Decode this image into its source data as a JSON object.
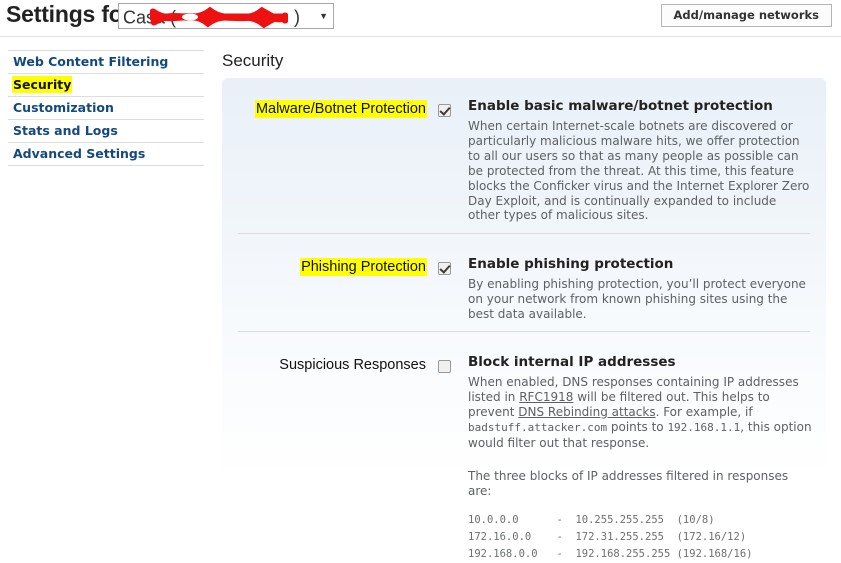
{
  "header": {
    "settings_for_label": "Settings for:",
    "network_value": "Casa (",
    "network_value_suffix": ")",
    "dropdown_arrow": "chevron-down-icon",
    "dropdown_arrow_glyph": "▼",
    "add_manage_button": "Add/manage networks",
    "redaction_color": "#ee1111"
  },
  "sidebar": {
    "items": [
      {
        "label": "Web Content Filtering",
        "active": false
      },
      {
        "label": "Security",
        "active": true
      },
      {
        "label": "Customization",
        "active": false
      },
      {
        "label": "Stats and Logs",
        "active": false
      },
      {
        "label": "Advanced Settings",
        "active": false
      }
    ]
  },
  "content": {
    "title": "Security",
    "highlight_color": "#ffff00",
    "link_color": "#13497f",
    "sections": {
      "malware": {
        "label": "Malware/Botnet Protection",
        "label_highlighted": true,
        "checkbox_checked": true,
        "option_title": "Enable basic malware/botnet protection",
        "description": "When certain Internet-scale botnets are discovered or particularly malicious malware hits, we offer protection to all our users so that as many people as possible can be protected from the threat. At this time, this feature blocks the Conficker virus and the Internet Explorer Zero Day Exploit, and is continually expanded to include other types of malicious sites."
      },
      "phishing": {
        "label": "Phishing Protection",
        "label_highlighted": true,
        "checkbox_checked": true,
        "option_title": "Enable phishing protection",
        "description": "By enabling phishing protection, you’ll protect everyone on your network from known phishing sites using the best data available."
      },
      "suspicious": {
        "label": "Suspicious Responses",
        "label_highlighted": false,
        "checkbox_checked": false,
        "option_title": "Block internal IP addresses",
        "desc_part1": "When enabled, DNS responses containing IP addresses listed in ",
        "link1": "RFC1918",
        "desc_part2": " will be filtered out. This helps to prevent ",
        "link2": "DNS Rebinding attacks",
        "desc_part3": ". For example, if ",
        "mono1": "badstuff.attacker.com",
        "desc_part4": " points to ",
        "mono2": "192.168.1.1",
        "desc_part5": ", this option would filter out that response.",
        "blocks_intro": "The three blocks of IP addresses filtered in responses are:",
        "ip_blocks": [
          {
            "start": "10.0.0.0",
            "dash": "-",
            "end": "10.255.255.255",
            "cidr": "(10/8)"
          },
          {
            "start": "172.16.0.0",
            "dash": "-",
            "end": "172.31.255.255",
            "cidr": "(172.16/12)"
          },
          {
            "start": "192.168.0.0",
            "dash": "-",
            "end": "192.168.255.255",
            "cidr": "(192.168/16)"
          }
        ],
        "ip_blocks_text": "10.0.0.0      -  10.255.255.255  (10/8)\n172.16.0.0    -  172.31.255.255  (172.16/12)\n192.168.0.0   -  192.168.255.255 (192.168/16)"
      }
    }
  }
}
